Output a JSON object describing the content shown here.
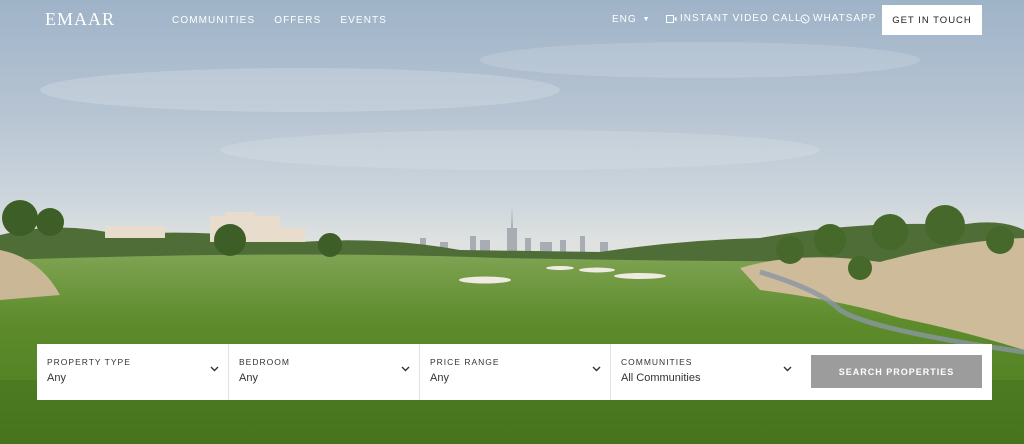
{
  "brand": {
    "logo_text": "EMAAR"
  },
  "nav": {
    "links": [
      "COMMUNITIES",
      "OFFERS",
      "EVENTS"
    ],
    "language": "ENG",
    "video_call": "INSTANT VIDEO CALL",
    "whatsapp": "WHATSAPP",
    "cta": "GET IN TOUCH"
  },
  "search": {
    "fields": [
      {
        "label": "PROPERTY TYPE",
        "value": "Any"
      },
      {
        "label": "BEDROOM",
        "value": "Any"
      },
      {
        "label": "PRICE RANGE",
        "value": "Any"
      },
      {
        "label": "COMMUNITIES",
        "value": "All Communities"
      }
    ],
    "button": "SEARCH PROPERTIES"
  },
  "icons": {
    "caret": "caret-down-icon",
    "video": "video-camera-icon",
    "whatsapp": "whatsapp-icon",
    "chevron": "chevron-down-icon"
  },
  "colors": {
    "search_button": "#9c9c9c",
    "grass": "#5f8a2e"
  }
}
